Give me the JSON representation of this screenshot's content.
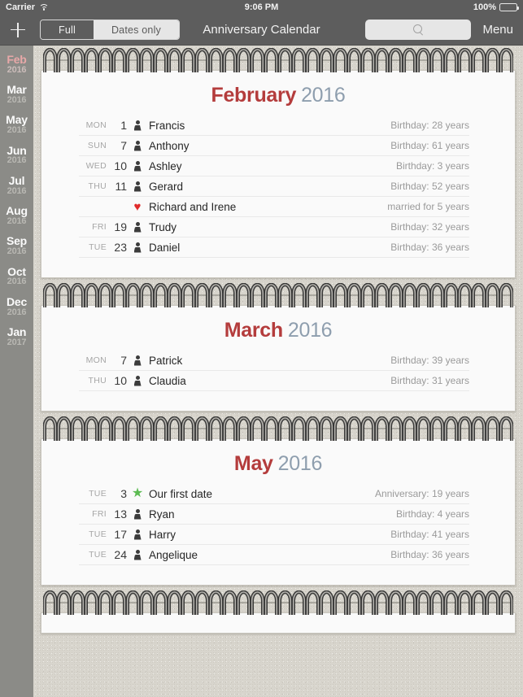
{
  "status_bar": {
    "carrier": "Carrier",
    "wifi_icon": "wifi-icon",
    "time": "9:06 PM",
    "battery_percent": "100%",
    "battery_icon": "battery-full-icon"
  },
  "nav_bar": {
    "add_icon": "plus-icon",
    "segmented": {
      "options": [
        "Full",
        "Dates only"
      ],
      "selected": "Full"
    },
    "title": "Anniversary Calendar",
    "search": {
      "icon": "search-icon",
      "value": "",
      "placeholder": ""
    },
    "menu_label": "Menu"
  },
  "sidebar": {
    "selected_index": 0,
    "items": [
      {
        "month": "Feb",
        "year": "2016"
      },
      {
        "month": "Mar",
        "year": "2016"
      },
      {
        "month": "May",
        "year": "2016"
      },
      {
        "month": "Jun",
        "year": "2016"
      },
      {
        "month": "Jul",
        "year": "2016"
      },
      {
        "month": "Aug",
        "year": "2016"
      },
      {
        "month": "Sep",
        "year": "2016"
      },
      {
        "month": "Oct",
        "year": "2016"
      },
      {
        "month": "Dec",
        "year": "2016"
      },
      {
        "month": "Jan",
        "year": "2017"
      }
    ]
  },
  "colors": {
    "month_name": "#b43c3c",
    "month_year": "#8e9eae",
    "nav_bar": "#5d5d5d",
    "sidebar": "#8b8b87",
    "paper": "#d8d5cd",
    "card": "#fafafa",
    "heart": "#e02b2b",
    "star": "#5cbb52",
    "selected_month": "#e8a8a8"
  },
  "months": [
    {
      "name": "February",
      "year": "2016",
      "entries": [
        {
          "dow": "MON",
          "day": "1",
          "icon": "person-icon",
          "name": "Francis",
          "detail": "Birthday: 28 years"
        },
        {
          "dow": "SUN",
          "day": "7",
          "icon": "person-icon",
          "name": "Anthony",
          "detail": "Birthday: 61 years"
        },
        {
          "dow": "WED",
          "day": "10",
          "icon": "person-icon",
          "name": "Ashley",
          "detail": "Birthday: 3 years"
        },
        {
          "dow": "THU",
          "day": "11",
          "icon": "person-icon",
          "name": "Gerard",
          "detail": "Birthday: 52 years"
        },
        {
          "dow": "",
          "day": "",
          "icon": "heart-icon",
          "name": "Richard and Irene",
          "detail": "married for 5 years"
        },
        {
          "dow": "FRI",
          "day": "19",
          "icon": "person-icon",
          "name": "Trudy",
          "detail": "Birthday: 32 years"
        },
        {
          "dow": "TUE",
          "day": "23",
          "icon": "person-icon",
          "name": "Daniel",
          "detail": "Birthday: 36 years"
        }
      ]
    },
    {
      "name": "March",
      "year": "2016",
      "entries": [
        {
          "dow": "MON",
          "day": "7",
          "icon": "person-icon",
          "name": "Patrick",
          "detail": "Birthday: 39 years"
        },
        {
          "dow": "THU",
          "day": "10",
          "icon": "person-icon",
          "name": "Claudia",
          "detail": "Birthday: 31 years"
        }
      ]
    },
    {
      "name": "May",
      "year": "2016",
      "entries": [
        {
          "dow": "TUE",
          "day": "3",
          "icon": "star-icon",
          "name": "Our first date",
          "detail": "Anniversary: 19 years"
        },
        {
          "dow": "FRI",
          "day": "13",
          "icon": "person-icon",
          "name": "Ryan",
          "detail": "Birthday: 4 years"
        },
        {
          "dow": "TUE",
          "day": "17",
          "icon": "person-icon",
          "name": "Harry",
          "detail": "Birthday: 41 years"
        },
        {
          "dow": "TUE",
          "day": "24",
          "icon": "person-icon",
          "name": "Angelique",
          "detail": "Birthday: 36 years"
        }
      ]
    },
    {
      "name": "",
      "year": "",
      "entries": []
    }
  ]
}
